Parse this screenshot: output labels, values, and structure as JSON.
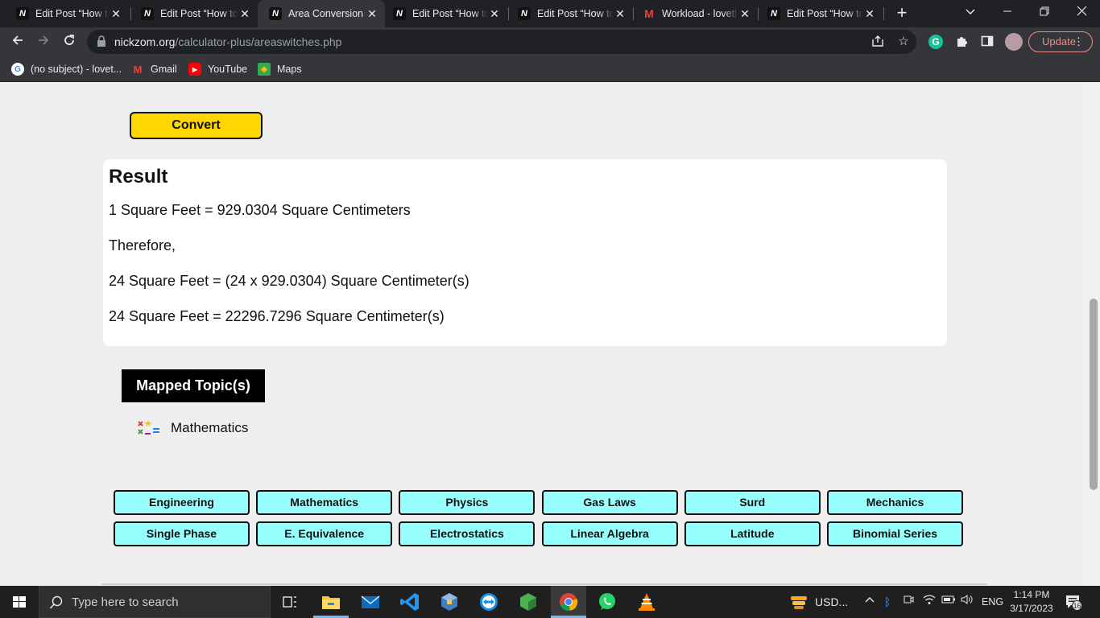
{
  "browser": {
    "tabs": [
      {
        "title": "Edit Post “How to",
        "favicon": "nickzom-icon",
        "active": false
      },
      {
        "title": "Edit Post “How to",
        "favicon": "nickzom-icon",
        "active": false
      },
      {
        "title": "Area Conversion",
        "favicon": "nickzom-icon",
        "active": true
      },
      {
        "title": "Edit Post “How to",
        "favicon": "nickzom-icon",
        "active": false
      },
      {
        "title": "Edit Post “How to",
        "favicon": "nickzom-icon",
        "active": false
      },
      {
        "title": "Workload - lovetl",
        "favicon": "gmail-icon",
        "active": false
      },
      {
        "title": "Edit Post “How to",
        "favicon": "nickzom-icon",
        "active": false
      }
    ],
    "url_host": "nickzom.org",
    "url_path": "/calculator-plus/areaswitches.php",
    "update_label": "Update",
    "bookmarks": [
      {
        "label": "(no subject) - lovet...",
        "icon": "google-icon"
      },
      {
        "label": "Gmail",
        "icon": "gmail-icon"
      },
      {
        "label": "YouTube",
        "icon": "youtube-icon"
      },
      {
        "label": "Maps",
        "icon": "maps-icon"
      }
    ]
  },
  "page": {
    "convert_label": "Convert",
    "result": {
      "heading": "Result",
      "lines": [
        "1 Square Feet = 929.0304 Square Centimeters",
        "Therefore,",
        "24 Square Feet = (24 x 929.0304) Square Centimeter(s)",
        "24 Square Feet = 22296.7296 Square Centimeter(s)"
      ]
    },
    "mapped_title": "Mapped Topic(s)",
    "mapped_topic": "Mathematics",
    "categories": [
      "Engineering",
      "Mathematics",
      "Physics",
      "Gas Laws",
      "Surd",
      "Mechanics",
      "Single Phase",
      "E. Equivalence",
      "Electrostatics",
      "Linear Algebra",
      "Latitude",
      "Binomial Series"
    ]
  },
  "taskbar": {
    "search_placeholder": "Type here to search",
    "weather_label": "USD...",
    "language": "ENG",
    "time": "1:14 PM",
    "date": "3/17/2023",
    "notification_count": "16"
  },
  "colors": {
    "convert_button": "#ffd700",
    "category_chip": "#98ffff",
    "update_accent": "#f28b82"
  }
}
